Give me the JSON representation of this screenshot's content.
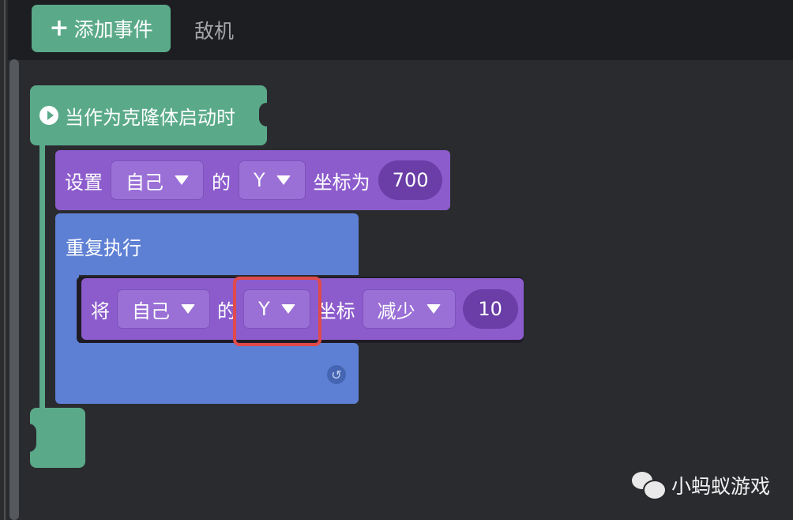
{
  "toolbar": {
    "add_event_icon": "plus-icon",
    "add_event_label": "添加事件",
    "tab_label": "敌机"
  },
  "event_block": {
    "icon": "play-icon",
    "label": "当作为克隆体启动时"
  },
  "set_block": {
    "prefix": "设置",
    "target": "自己",
    "of_label": "的",
    "axis": "Y",
    "suffix": "坐标为",
    "value": "700"
  },
  "repeat_block": {
    "label": "重复执行",
    "loop_icon": "loop-arrow-icon"
  },
  "change_block": {
    "prefix": "将",
    "target": "自己",
    "of_label": "的",
    "axis": "Y",
    "suffix": "坐标",
    "operation": "减少",
    "value": "10",
    "highlighted_field": "axis"
  },
  "colors": {
    "event_green": "#5aaa8a",
    "motion_purple": "#8c5ccc",
    "control_blue": "#5e80d4",
    "highlight_red": "#e04a4a"
  },
  "watermark": {
    "icon": "wechat-icon",
    "text": "小蚂蚁游戏"
  }
}
